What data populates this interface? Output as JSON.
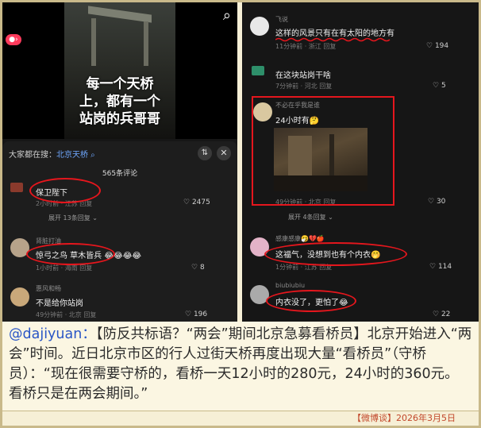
{
  "left": {
    "video_caption_lines": [
      "每一个天桥",
      "上，都有一个",
      "站岗的兵哥哥"
    ],
    "search_prefix": "大家都在搜：",
    "search_term": "北京天桥",
    "comment_count": "565条评论",
    "comments": [
      {
        "user": "",
        "text": "保卫陛下",
        "meta": "2小时前 · 江苏  回复",
        "likes": "2475",
        "expand": "展开 13条回复"
      },
      {
        "user": "肾脏打油",
        "text": "惊弓之鸟   草木皆兵 😂😂😂😂",
        "meta": "1小时前 · 海南  回复",
        "likes": "8"
      },
      {
        "user": "惠风和畅",
        "text": "不是给你站岗",
        "meta": "49分钟前 · 北京  回复",
        "likes": "196"
      }
    ]
  },
  "right": {
    "comments": [
      {
        "user": "飞说",
        "text": "这样的风景只有在有太阳的地方有",
        "meta": "11分钟前 · 浙江  回复",
        "likes": "194"
      },
      {
        "user": "",
        "text": "在这块站岗干啥",
        "meta": "7分钟前 · 河北  回复",
        "likes": "5"
      },
      {
        "user": "不必在乎我是谁",
        "text": "24小时有🤔",
        "meta": "49分钟前 · 北京  回复",
        "likes": "30",
        "expand": "展开 4条回复"
      },
      {
        "user": "感康感康🤧💔🍎",
        "text": "这福气，没想到也有个内衣🤭",
        "meta": "1分钟前 · 江苏  回复",
        "likes": "114"
      },
      {
        "user": "biubiubiu",
        "text": "内衣没了，更怕了😂",
        "meta": "",
        "likes": "22"
      }
    ]
  },
  "caption": {
    "handle": "@dajiyuan：",
    "body": "【防反共标语？“两会”期间北京急募看桥员】北京开始进入“两会”时间。近日北京市区的行人过街天桥再度出现大量“看桥员”（守桥员）：“现在很需要守桥的，看桥一天12小时的280元，24小时的360元。看桥只是在两会期间。”",
    "footer": "【微博谈】2026年3月5日"
  },
  "icons": {
    "search": "search-icon",
    "heart": "heart-icon",
    "close": "close-icon"
  },
  "colors": {
    "highlight_red": "#e5161d",
    "link_blue": "#2a56c6",
    "footer_red": "#c2472a"
  }
}
